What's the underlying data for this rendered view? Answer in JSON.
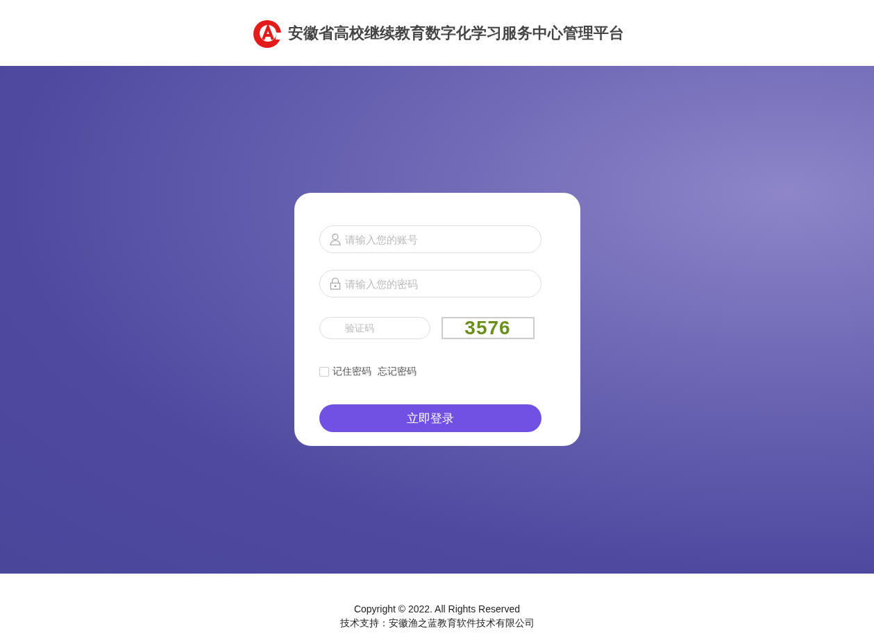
{
  "header": {
    "title": "安徽省高校继续教育数字化学习服务中心管理平台"
  },
  "login": {
    "account": {
      "placeholder": "请输入您的账号"
    },
    "password": {
      "placeholder": "请输入您的密码"
    },
    "captcha": {
      "placeholder": "验证码",
      "code": "3576"
    },
    "remember": {
      "label": "记住密码",
      "checked": false
    },
    "forgot": "忘记密码",
    "submit": "立即登录"
  },
  "footer": {
    "copyright": "Copyright © 2022. All Rights Reserved",
    "support": "技术支持：安徽渔之蓝教育软件技术有限公司"
  }
}
